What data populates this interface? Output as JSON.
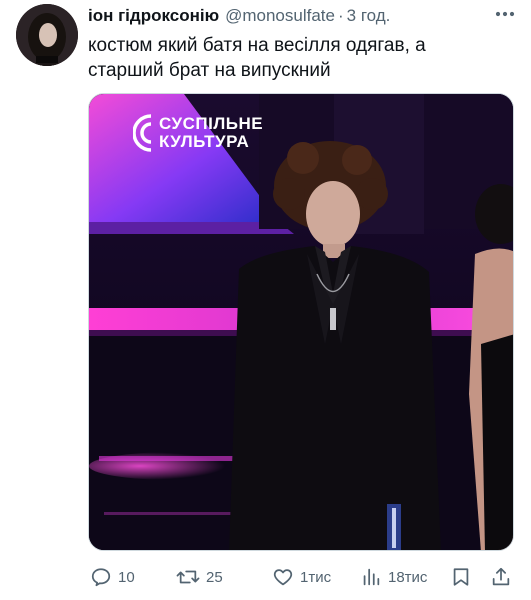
{
  "tweet": {
    "author_name": "іон гідроксонію",
    "handle": "@monosulfate",
    "separator": "·",
    "time": "3 год.",
    "text_lines": [
      "костюм який батя на весілля одягав, а",
      "старший брат на випускний"
    ]
  },
  "media": {
    "watermark_lines": [
      "СУСПІЛЬНЕ",
      "КУЛЬТУРА"
    ]
  },
  "actions": {
    "replies": "10",
    "reposts": "25",
    "likes": "1тис",
    "views": "18тис"
  },
  "icons": {
    "more": "more-dots-icon",
    "reply": "reply-icon",
    "repost": "repost-icon",
    "like": "heart-icon",
    "views": "views-chart-icon",
    "bookmark": "bookmark-icon",
    "share": "share-icon"
  },
  "colors": {
    "text_primary": "#0f1419",
    "text_secondary": "#536471",
    "stage_magenta": "#e23bd6",
    "stage_blue": "#3b2bd1"
  }
}
